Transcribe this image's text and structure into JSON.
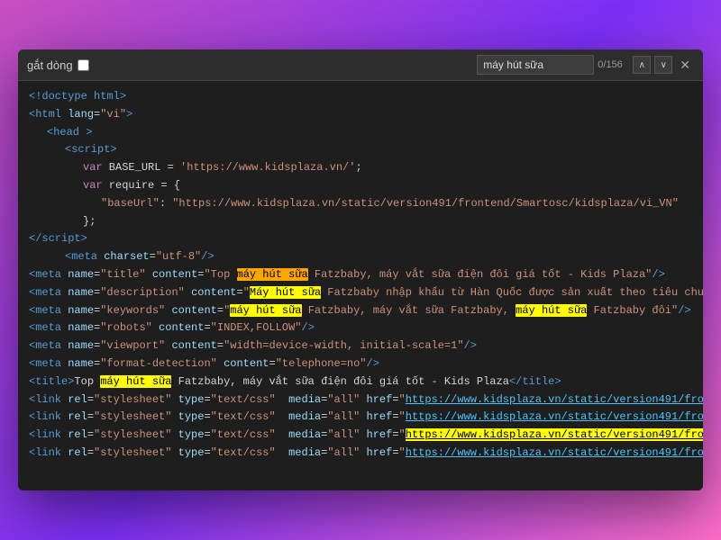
{
  "toolbar": {
    "wrap_label": "gắt dòng",
    "search_placeholder": "máy hút sữa",
    "search_count": "0/156",
    "btn_prev": "∧",
    "btn_next": "∨",
    "btn_close": "✕"
  },
  "code": {
    "lines": []
  }
}
